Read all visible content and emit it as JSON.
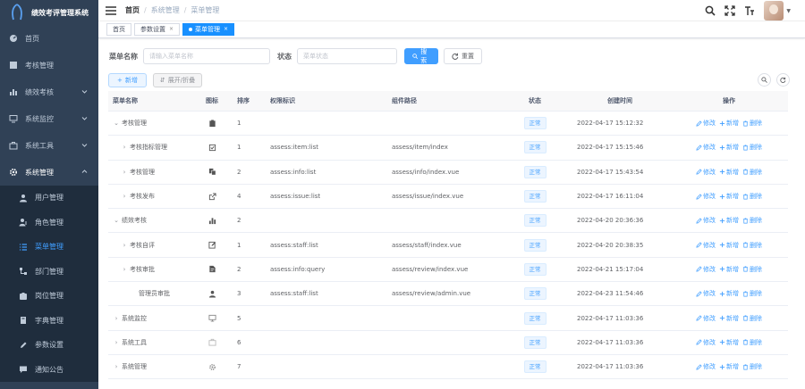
{
  "app": {
    "title": "绩效考评管理系统"
  },
  "sidebar": {
    "items": [
      {
        "label": "首页",
        "icon": "dashboard-icon"
      },
      {
        "label": "考核管理",
        "icon": "clipboard-icon"
      },
      {
        "label": "绩效考核",
        "icon": "bar-chart-icon"
      },
      {
        "label": "系统监控",
        "icon": "monitor-icon"
      },
      {
        "label": "系统工具",
        "icon": "toolbox-icon"
      },
      {
        "label": "系统管理",
        "icon": "gear-icon"
      }
    ],
    "sub": [
      {
        "label": "用户管理",
        "icon": "user-icon"
      },
      {
        "label": "角色管理",
        "icon": "role-icon"
      },
      {
        "label": "菜单管理",
        "icon": "list-icon"
      },
      {
        "label": "部门管理",
        "icon": "tree-icon"
      },
      {
        "label": "岗位管理",
        "icon": "post-icon"
      },
      {
        "label": "字典管理",
        "icon": "book-icon"
      },
      {
        "label": "参数设置",
        "icon": "edit-icon"
      },
      {
        "label": "通知公告",
        "icon": "message-icon"
      }
    ]
  },
  "header": {
    "breadcrumb": [
      "首页",
      "系统管理",
      "菜单管理"
    ],
    "sep": "/"
  },
  "tags": [
    {
      "label": "首页"
    },
    {
      "label": "参数设置",
      "close": "×"
    },
    {
      "label": "菜单管理",
      "close": "×"
    }
  ],
  "search": {
    "menu_name_label": "菜单名称",
    "menu_name_placeholder": "请输入菜单名称",
    "status_label": "状态",
    "status_placeholder": "菜单状态",
    "search_button": "搜索",
    "reset_button": "重置"
  },
  "toolbar": {
    "add_button": "新增",
    "expand_button": "展开/折叠"
  },
  "table": {
    "headers": [
      "菜单名称",
      "图标",
      "排序",
      "权限标识",
      "组件路径",
      "状态",
      "创建时间",
      "操作"
    ],
    "status_text": "正常",
    "ops": {
      "edit": "修改",
      "add": "新增",
      "delete": "删除"
    },
    "rows": [
      {
        "name": "考核管理",
        "icon": "clipboard-icon",
        "order": "1",
        "perm": "",
        "comp": "",
        "time": "2022-04-17 15:12:32",
        "arrow": "⌄",
        "level": 0
      },
      {
        "name": "考核指标管理",
        "icon": "checkbox-icon",
        "order": "1",
        "perm": "assess:item:list",
        "comp": "assess/item/index",
        "time": "2022-04-17 15:15:46",
        "arrow": "›",
        "level": 1
      },
      {
        "name": "考核管理",
        "icon": "copy-icon",
        "order": "2",
        "perm": "assess:info:list",
        "comp": "assess/info/index.vue",
        "time": "2022-04-17 15:43:54",
        "arrow": "›",
        "level": 1
      },
      {
        "name": "考核发布",
        "icon": "share-icon",
        "order": "4",
        "perm": "assess:issue:list",
        "comp": "assess/issue/index.vue",
        "time": "2022-04-17 16:11:04",
        "arrow": "›",
        "level": 1
      },
      {
        "name": "绩效考核",
        "icon": "bar-chart-icon",
        "order": "2",
        "perm": "",
        "comp": "",
        "time": "2022-04-20 20:36:36",
        "arrow": "⌄",
        "level": 0
      },
      {
        "name": "考核自评",
        "icon": "edit-icon",
        "order": "1",
        "perm": "assess:staff:list",
        "comp": "assess/staff/index.vue",
        "time": "2022-04-20 20:38:35",
        "arrow": "›",
        "level": 1
      },
      {
        "name": "考核审批",
        "icon": "document-icon",
        "order": "2",
        "perm": "assess:info:query",
        "comp": "assess/review/index.vue",
        "time": "2022-04-21 15:17:04",
        "arrow": "›",
        "level": 1
      },
      {
        "name": "管理员审批",
        "icon": "user-icon",
        "order": "3",
        "perm": "assess:staff:list",
        "comp": "assess/review/admin.vue",
        "time": "2022-04-23 11:54:46",
        "arrow": "",
        "level": 2
      },
      {
        "name": "系统监控",
        "icon": "monitor-icon",
        "order": "5",
        "perm": "",
        "comp": "",
        "time": "2022-04-17 11:03:36",
        "arrow": "›",
        "level": 0
      },
      {
        "name": "系统工具",
        "icon": "toolbox-icon",
        "order": "6",
        "perm": "",
        "comp": "",
        "time": "2022-04-17 11:03:36",
        "arrow": "›",
        "level": 0
      },
      {
        "name": "系统管理",
        "icon": "gear-icon",
        "order": "7",
        "perm": "",
        "comp": "",
        "time": "2022-04-17 11:03:36",
        "arrow": "›",
        "level": 0
      }
    ]
  },
  "colors": {
    "sidebar_bg": "#304156",
    "submenu_bg": "#1f2d3d",
    "primary": "#409eff",
    "tag_active": "#1890ff"
  }
}
